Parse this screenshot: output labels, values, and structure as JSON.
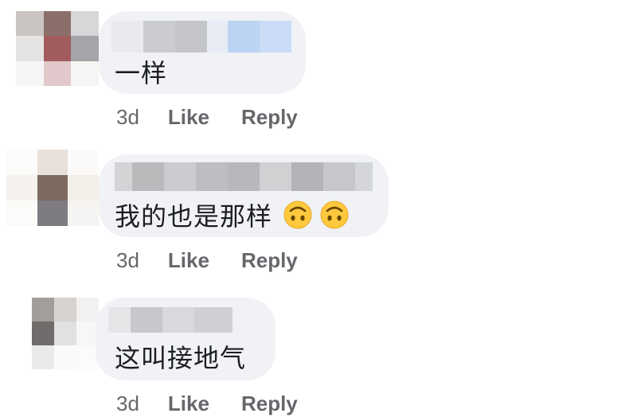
{
  "comments": [
    {
      "text": "一样",
      "emojis": [],
      "time": "3d",
      "like_label": "Like",
      "reply_label": "Reply"
    },
    {
      "text": "我的也是那样",
      "emojis": [
        "upside-down-face",
        "upside-down-face"
      ],
      "time": "3d",
      "like_label": "Like",
      "reply_label": "Reply"
    },
    {
      "text": "这叫接地气",
      "emojis": [],
      "time": "3d",
      "like_label": "Like",
      "reply_label": "Reply"
    }
  ],
  "colors": {
    "bubble": "#f0f2f5",
    "text": "#1c1e21",
    "meta": "#65676b",
    "emoji_face": "#ffc83d"
  },
  "icons": {
    "emoji": "upside-down-face-icon"
  }
}
